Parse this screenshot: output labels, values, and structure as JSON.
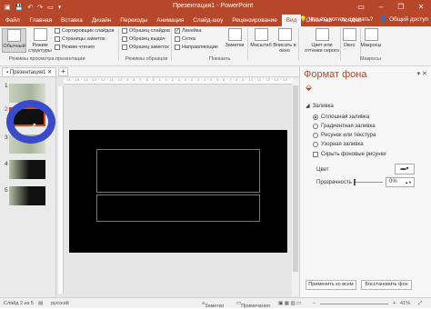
{
  "window": {
    "title": "Презентация1 - PowerPoint",
    "minimize": "–",
    "maximize": "❐",
    "close": "✕"
  },
  "ribbon_tabs": [
    "Файл",
    "Главная",
    "Вставка",
    "Дизайн",
    "Переходы",
    "Анимация",
    "Слайд-шоу",
    "Рецензирование",
    "Вид",
    "Office Tab",
    "Acrobat"
  ],
  "tabs_extra": {
    "help": "Что вы хотите сделать?",
    "share": "Общий доступ"
  },
  "ribbon": {
    "normal": "Обычный",
    "outline": "Режим структуры",
    "sorter": "Сортировщик слайдов",
    "notes_page": "Страницы заметок",
    "reading": "Режим чтения",
    "slide_master": "Образец слайдов",
    "handout_master": "Образец выдач",
    "notes_master": "Образец заметок",
    "ruler": "Линейка",
    "grid": "Сетка",
    "guides": "Направляющие",
    "notes": "Заметки",
    "zoom": "Масштаб",
    "fit": "Вписать в окно",
    "color": "Цвет или оттенки серого",
    "window": "Окно",
    "macros": "Макросы",
    "group_views": "Режимы просмотра презентации",
    "group_masters": "Режимы образцов",
    "group_show": "Показать",
    "group_macros": "Макросы"
  },
  "doc_tab": "Презентация1",
  "slides": [
    "1",
    "2",
    "3",
    "4",
    "5"
  ],
  "ruler_h": "· 16 · 15 · 14 · 13 · 12 · 11 · 10 · 9 · 8 · 7 · 6 · 5 · 4 · 3 · 2 · 1 · 0 · 1 · 2 · 3 · 4 · 5 · 6 · 7 · 8 · 9 · 10 · 11 · 12 · 13 · 14 · 15 · 16 ·",
  "pane": {
    "title": "Формат фона",
    "section": "Заливка",
    "options": [
      "Сплошная заливка",
      "Градиентная заливка",
      "Рисунок или текстура",
      "Узорная заливка"
    ],
    "hide_bg": "Скрыть фоновые рисунки",
    "color_label": "Цвет",
    "transparency_label": "Прозрачность",
    "transparency_value": "0%",
    "apply_all": "Применить ко всем",
    "reset": "Восстановить фон"
  },
  "status": {
    "slide": "Слайд 2 из 5",
    "lang": "русский",
    "notes": "Заметки",
    "comments": "Примечания",
    "zoom": "41%"
  },
  "colors": {
    "accent": "#b7472a",
    "slide_bg": "#000000"
  }
}
